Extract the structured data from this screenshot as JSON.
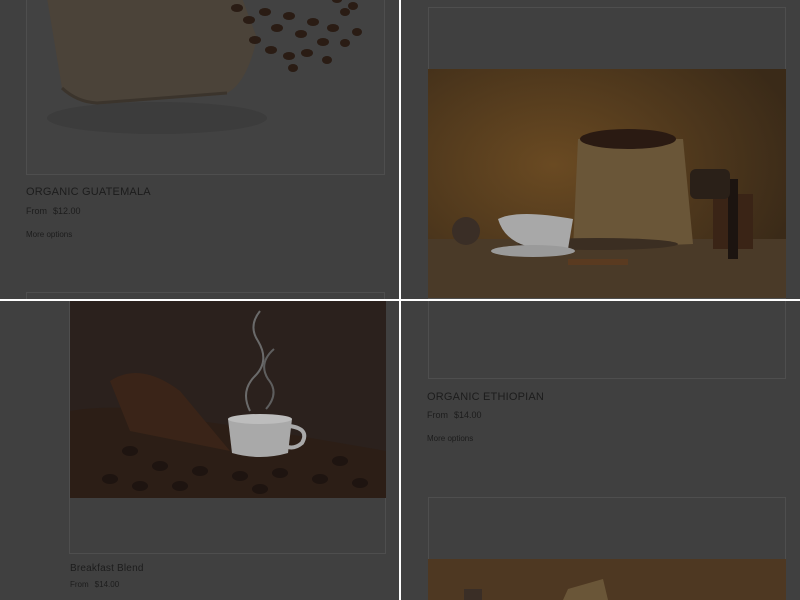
{
  "colors": {
    "page_overlay": "#404040",
    "divider": "#ffffff",
    "text": "#1c1c1c",
    "card_border": "#4e4e4e"
  },
  "products": [
    {
      "title": "ORGANIC GUATEMALA",
      "price_prefix": "From",
      "price": "$12.00",
      "options_label": "More options",
      "image": "coffee-sack-beans-photo"
    },
    {
      "title": "ORGANIC ETHIOPIAN",
      "price_prefix": "From",
      "price": "$14.00",
      "options_label": "More options",
      "image": "coffee-sack-grinder-cup-photo"
    },
    {
      "title": "Breakfast Blend",
      "price_prefix": "From",
      "price": "$14.00",
      "image": "steaming-coffee-cup-beans-photo"
    },
    {
      "image": "coffee-sack-grinder-cup-photo"
    }
  ]
}
